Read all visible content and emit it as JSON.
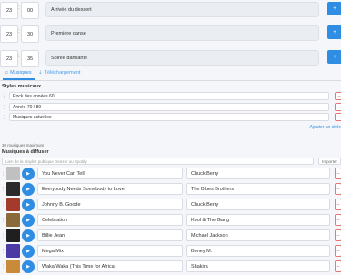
{
  "schedule": [
    {
      "hours": "23",
      "minutes": "00",
      "title": "Arrivée du dessert",
      "action_icon": "plus-icon"
    },
    {
      "hours": "23",
      "minutes": "30",
      "title": "Première danse",
      "action_icon": "plus-icon"
    },
    {
      "hours": "23",
      "minutes": "35",
      "title": "Soirée dansante",
      "action_icon": "plus-icon"
    }
  ],
  "separator": ":",
  "tabs": [
    {
      "label": "Musiques",
      "icon": "music-icon"
    },
    {
      "label": "Téléchargement",
      "icon": "download-icon"
    }
  ],
  "styles": {
    "heading": "Styles musicaux",
    "items": [
      {
        "value": "Rock des années 60"
      },
      {
        "value": "Année 70 / 80"
      },
      {
        "value": "Musiques actuelles"
      }
    ],
    "add_link": "Ajouter un style",
    "delete_glyph": "–"
  },
  "songs_section": {
    "count_label": "30 musiques maximum",
    "heading": "Musiques à diffuser",
    "playlist_placeholder": "Lien de la playlist publique Deezer ou Spotify",
    "import_label": "Importer"
  },
  "songs": [
    {
      "title": "You Never Can Tell",
      "artist": "Chuck Berry",
      "color": "#c0c0c0"
    },
    {
      "title": "Everybody Needs Somebody to Love",
      "artist": "The Blues Brothers",
      "color": "#2b2b2b"
    },
    {
      "title": "Johnny B. Goode",
      "artist": "Chuck Berry",
      "color": "#a33b2c"
    },
    {
      "title": "Celebration",
      "artist": "Kool & The Gang",
      "color": "#8a6a3a"
    },
    {
      "title": "Billie Jean",
      "artist": "Michael Jackson",
      "color": "#1f1f1f"
    },
    {
      "title": "Mega Mix",
      "artist": "Boney M.",
      "color": "#4b3aa3"
    },
    {
      "title": "Waka Waka (This Time for Africa)",
      "artist": "Shakira",
      "color": "#c98a3a"
    }
  ],
  "colors": {
    "accent": "#2f8de4",
    "danger": "#d64545"
  }
}
